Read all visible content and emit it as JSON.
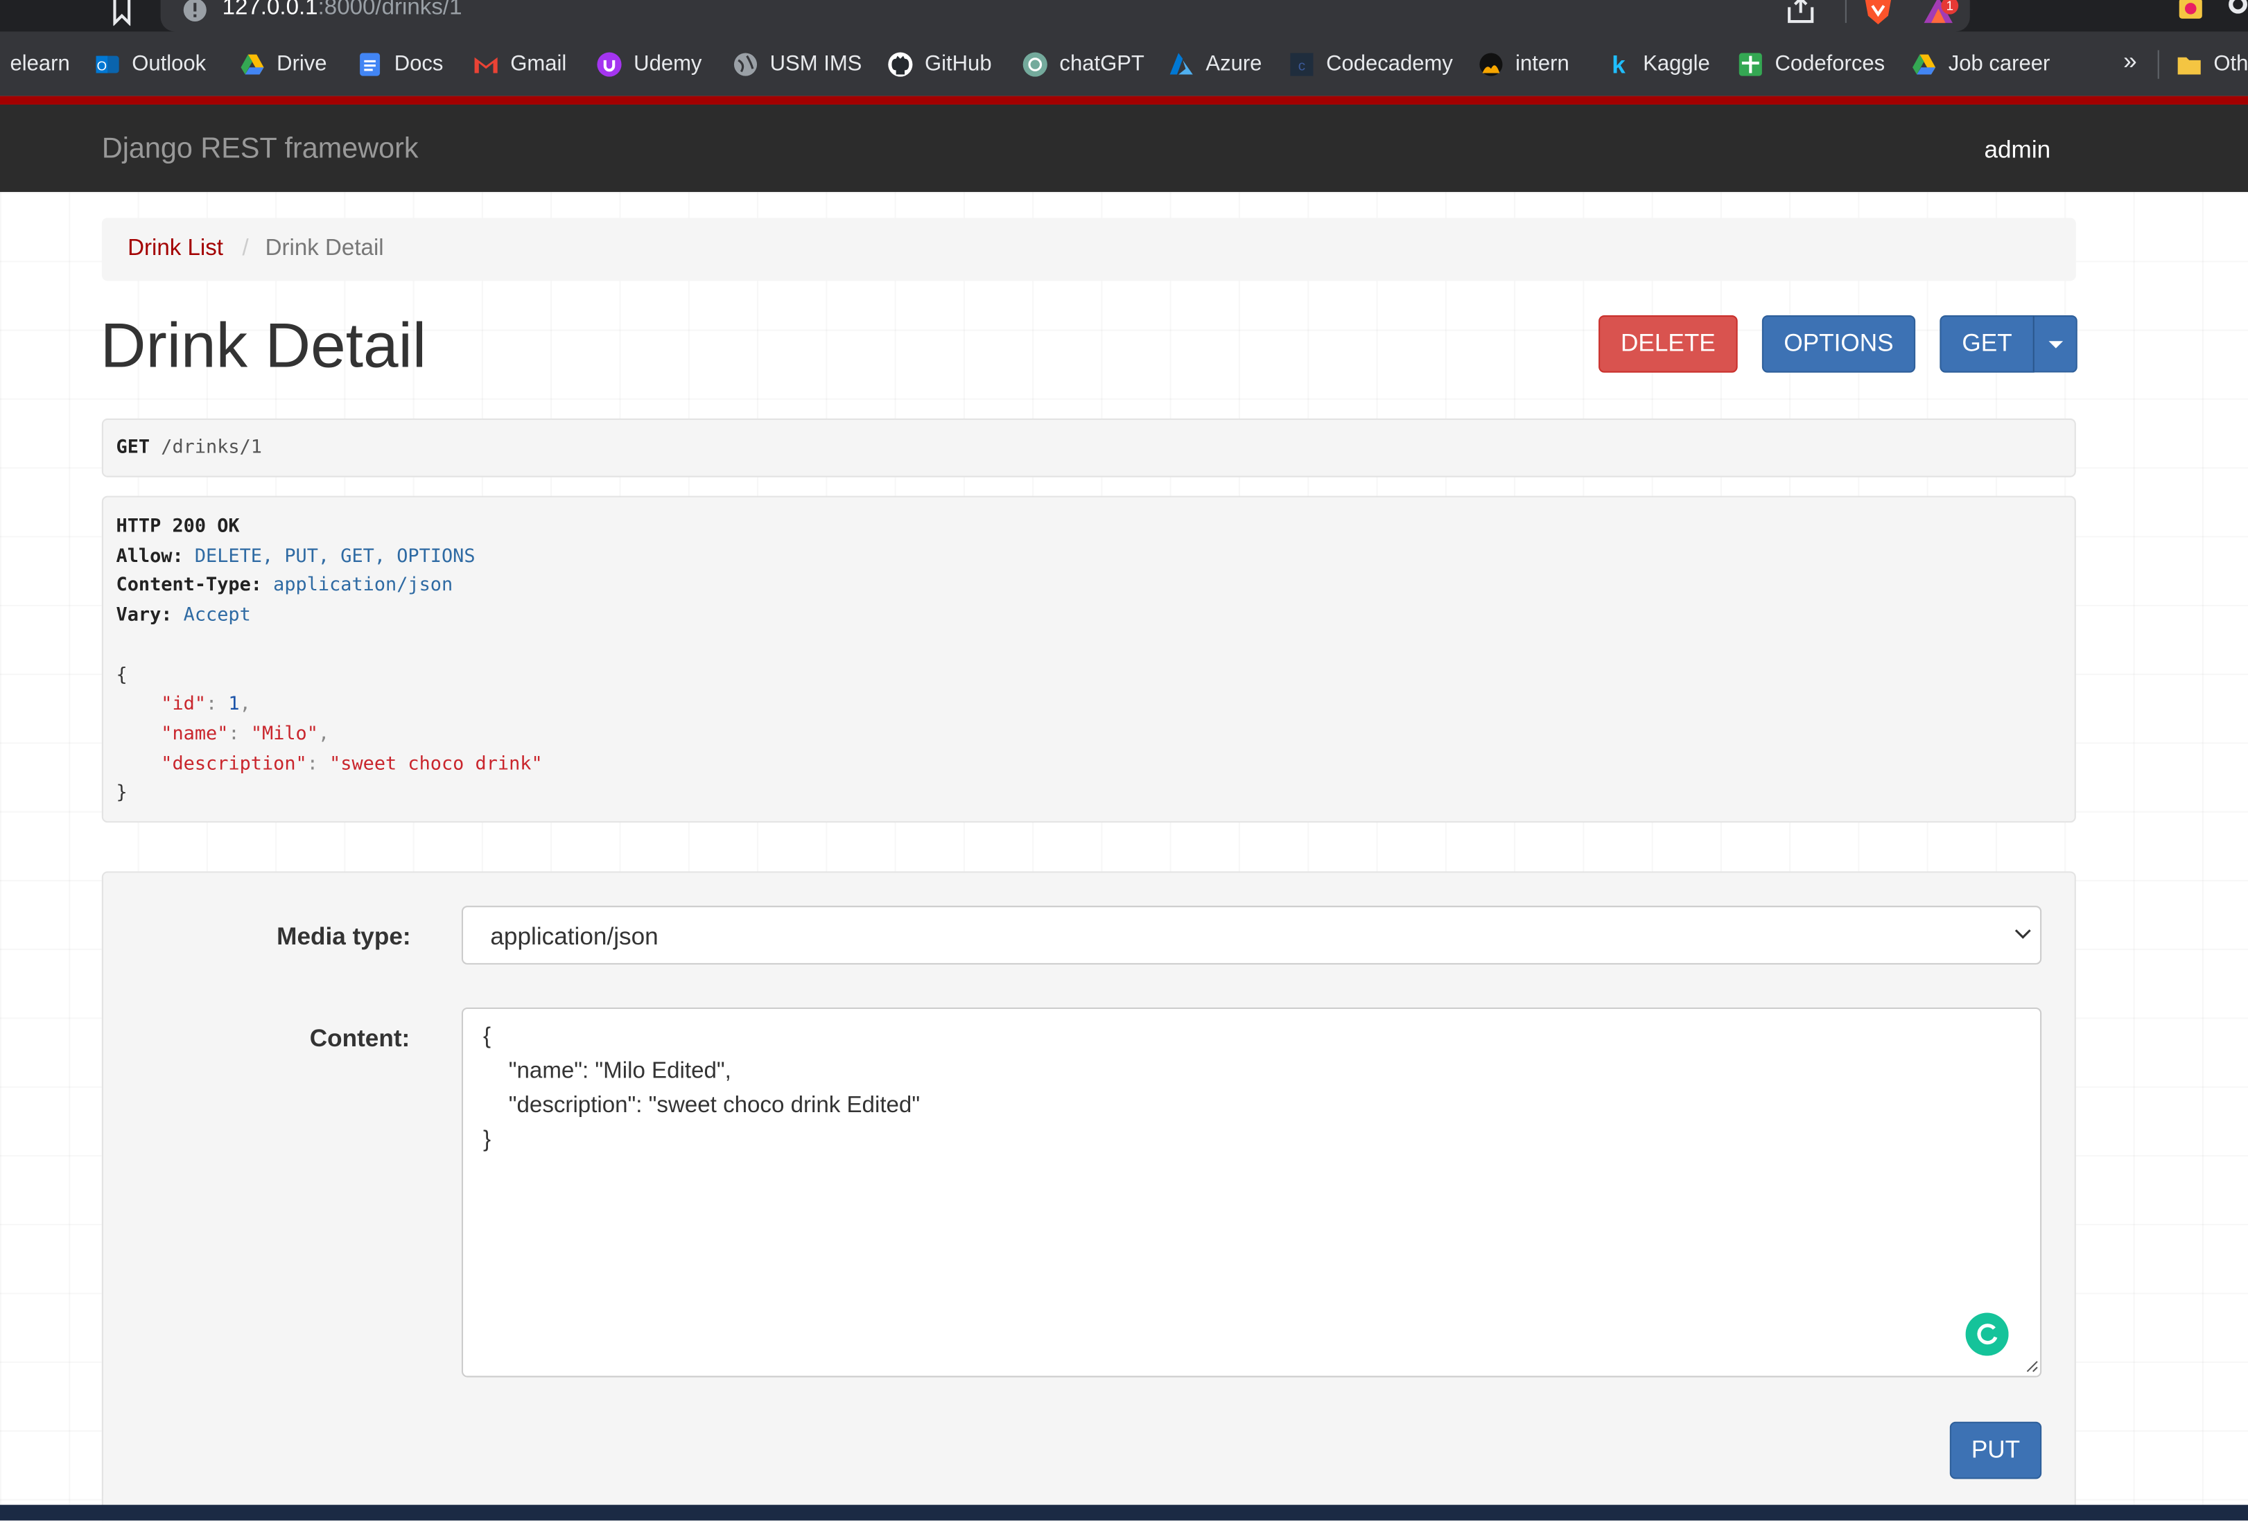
{
  "browser": {
    "url_host": "127.0.0.1",
    "url_rest": ":8000/drinks/1",
    "rewards_badge": "1",
    "bookmarks": [
      {
        "label": "elearn",
        "icon": "none"
      },
      {
        "label": "Outlook",
        "icon": "outlook-icon"
      },
      {
        "label": "Drive",
        "icon": "google-drive-icon"
      },
      {
        "label": "Docs",
        "icon": "google-docs-icon"
      },
      {
        "label": "Gmail",
        "icon": "gmail-icon"
      },
      {
        "label": "Udemy",
        "icon": "udemy-icon"
      },
      {
        "label": "USM IMS",
        "icon": "globe-icon"
      },
      {
        "label": "GitHub",
        "icon": "github-icon"
      },
      {
        "label": "chatGPT",
        "icon": "chatgpt-icon"
      },
      {
        "label": "Azure",
        "icon": "azure-icon"
      },
      {
        "label": "Codecademy",
        "icon": "codecademy-icon"
      },
      {
        "label": "intern",
        "icon": "intern-icon"
      },
      {
        "label": "Kaggle",
        "icon": "kaggle-icon"
      },
      {
        "label": "Codeforces",
        "icon": "codeforces-icon"
      },
      {
        "label": "Job career",
        "icon": "google-drive-icon"
      }
    ],
    "more_bookmarks": "»",
    "other_bookmarks": "Oth"
  },
  "navbar": {
    "brand": "Django REST framework",
    "user": "admin"
  },
  "breadcrumb": {
    "link": "Drink List",
    "separator": "/",
    "active": "Drink Detail"
  },
  "page": {
    "title": "Drink Detail"
  },
  "buttons": {
    "delete": "DELETE",
    "options": "OPTIONS",
    "get": "GET",
    "put": "PUT"
  },
  "request": {
    "method": "GET",
    "path": "/drinks/1"
  },
  "response": {
    "status": "HTTP 200 OK",
    "allow_label": "Allow:",
    "allow_value": "DELETE, PUT, GET, OPTIONS",
    "content_type_label": "Content-Type:",
    "content_type_value": "application/json",
    "vary_label": "Vary:",
    "vary_value": "Accept",
    "body": {
      "open": "{",
      "id_key": "\"id\"",
      "id_value": "1",
      "name_key": "\"name\"",
      "name_value": "\"Milo\"",
      "description_key": "\"description\"",
      "description_value": "\"sweet choco drink\"",
      "close": "}"
    }
  },
  "form": {
    "media_type_label": "Media type:",
    "media_type_value": "application/json",
    "content_label": "Content:",
    "content_lines": [
      "{",
      "    \"name\": \"Milo Edited\",",
      "    \"description\": \"sweet choco drink Edited\"",
      "}"
    ]
  },
  "colors": {
    "accent_red": "#a30000",
    "navbar_bg": "#2c2c2c",
    "delete_btn": "#d9534f",
    "primary_btn": "#3d72b4"
  }
}
